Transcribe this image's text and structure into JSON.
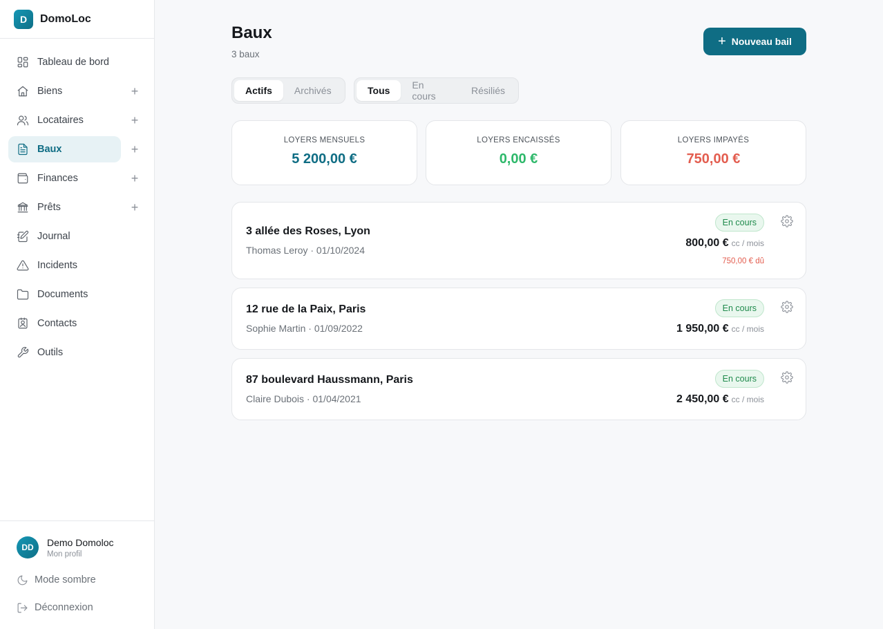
{
  "brand": {
    "logo_letter": "D",
    "name": "DomoLoc"
  },
  "nav": [
    {
      "label": "Tableau de bord",
      "icon": "dashboard-icon",
      "plus": false,
      "active": false
    },
    {
      "label": "Biens",
      "icon": "home-icon",
      "plus": true,
      "active": false
    },
    {
      "label": "Locataires",
      "icon": "users-icon",
      "plus": true,
      "active": false
    },
    {
      "label": "Baux",
      "icon": "document-icon",
      "plus": true,
      "active": true
    },
    {
      "label": "Finances",
      "icon": "wallet-icon",
      "plus": true,
      "active": false
    },
    {
      "label": "Prêts",
      "icon": "bank-icon",
      "plus": true,
      "active": false
    },
    {
      "label": "Journal",
      "icon": "journal-icon",
      "plus": false,
      "active": false
    },
    {
      "label": "Incidents",
      "icon": "alert-icon",
      "plus": false,
      "active": false
    },
    {
      "label": "Documents",
      "icon": "folder-icon",
      "plus": false,
      "active": false
    },
    {
      "label": "Contacts",
      "icon": "contact-card-icon",
      "plus": false,
      "active": false
    },
    {
      "label": "Outils",
      "icon": "wrench-icon",
      "plus": false,
      "active": false
    }
  ],
  "profile": {
    "initials": "DD",
    "name": "Demo Domoloc",
    "subtitle": "Mon profil"
  },
  "footer": {
    "dark_mode": "Mode sombre",
    "logout": "Déconnexion"
  },
  "header": {
    "title": "Baux",
    "count": "3 baux",
    "new_button": "Nouveau bail"
  },
  "filters": {
    "archive": [
      {
        "label": "Actifs",
        "active": true
      },
      {
        "label": "Archivés",
        "active": false
      }
    ],
    "status": [
      {
        "label": "Tous",
        "active": true
      },
      {
        "label": "En cours",
        "active": false
      },
      {
        "label": "Résiliés",
        "active": false
      }
    ]
  },
  "stats": [
    {
      "label": "LOYERS MENSUELS",
      "value": "5 200,00 €",
      "color": "#0f6d84"
    },
    {
      "label": "LOYERS ENCAISSÉS",
      "value": "0,00 €",
      "color": "#2db86a"
    },
    {
      "label": "LOYERS IMPAYÉS",
      "value": "750,00 €",
      "color": "#e35d4f"
    }
  ],
  "leases": [
    {
      "address": "3 allée des Roses, Lyon",
      "sub": "Thomas Leroy · 01/10/2024",
      "status": "En cours",
      "amount": "800,00 €",
      "per": "cc / mois",
      "due": "750,00 € dû"
    },
    {
      "address": "12 rue de la Paix, Paris",
      "sub": "Sophie Martin · 01/09/2022",
      "status": "En cours",
      "amount": "1 950,00 €",
      "per": "cc / mois"
    },
    {
      "address": "87 boulevard Haussmann, Paris",
      "sub": "Claire Dubois · 01/04/2021",
      "status": "En cours",
      "amount": "2 450,00 €",
      "per": "cc / mois"
    }
  ],
  "colors": {
    "accent": "#0f6d84",
    "success": "#2db86a",
    "danger": "#e35d4f"
  }
}
